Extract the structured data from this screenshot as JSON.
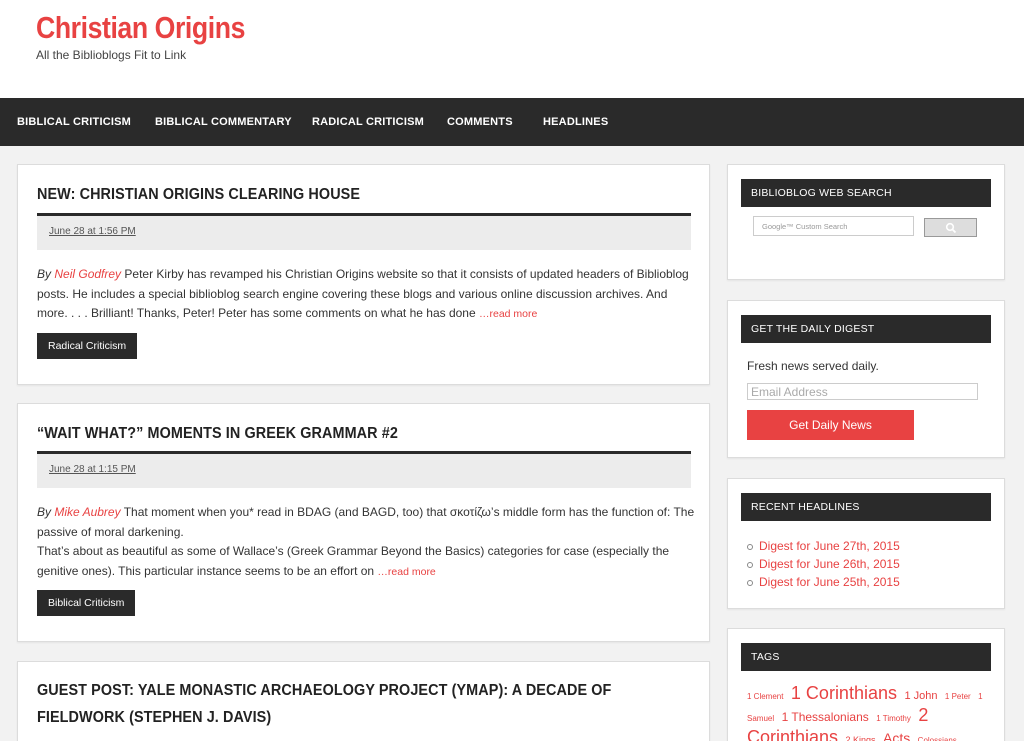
{
  "site": {
    "title": "Christian Origins",
    "description": "All the Biblioblogs Fit to Link"
  },
  "nav": {
    "items": [
      {
        "label": "BIBLICAL CRITICISM"
      },
      {
        "label": "BIBLICAL COMMENTARY"
      },
      {
        "label": "RADICAL CRITICISM"
      },
      {
        "label": "COMMENTS"
      },
      {
        "label": "HEADLINES"
      }
    ]
  },
  "posts": [
    {
      "title": "NEW: CHRISTIAN ORIGINS CLEARING HOUSE",
      "date": "June 28 at 1:56 PM",
      "by": "By",
      "author": "Neil Godfrey",
      "excerpt": " Peter Kirby has revamped his Christian Origins website so that it consists of updated headers of Biblioblog posts. He includes a special biblioblog search engine covering these blogs and various online discussion archives. And more. . . . Brilliant! Thanks, Peter! Peter has some comments on what he has done ",
      "readmore": "…read more",
      "category": "Radical Criticism"
    },
    {
      "title": "“WAIT WHAT?” MOMENTS IN GREEK GRAMMAR #2",
      "date": "June 28 at 1:15 PM",
      "by": "By",
      "author": "Mike Aubrey",
      "excerpt": " That moment when you* read in BDAG (and BAGD, too) that σκοτίζω’s middle form has the function of: The passive of moral darkening.",
      "excerpt2": "That’s about as beautiful as some of Wallace’s (Greek Grammar Beyond the Basics) categories for case (especially the genitive ones). This particular instance seems to be an effort on ",
      "readmore": "…read more",
      "category": "Biblical Criticism"
    },
    {
      "title": "GUEST POST: YALE MONASTIC ARCHAEOLOGY PROJECT (YMAP): A DECADE OF FIELDWORK (STEPHEN J. DAVIS)"
    }
  ],
  "sidebar": {
    "search": {
      "title": "BIBLIOBLOG WEB SEARCH",
      "placeholder": "Google™ Custom Search"
    },
    "digest": {
      "title": "GET THE DAILY DIGEST",
      "text": "Fresh news served daily.",
      "email_placeholder": "Email Address",
      "button": "Get Daily News"
    },
    "headlines": {
      "title": "RECENT HEADLINES",
      "items": [
        "Digest for June 27th, 2015",
        "Digest for June 26th, 2015",
        "Digest for June 25th, 2015"
      ]
    },
    "tags": {
      "title": "TAGS",
      "items": [
        {
          "label": "1 Clement",
          "size": 8
        },
        {
          "label": "1 Corinthians",
          "size": 18
        },
        {
          "label": "1 John",
          "size": 11
        },
        {
          "label": "1 Peter",
          "size": 8
        },
        {
          "label": "1 Samuel",
          "size": 8
        },
        {
          "label": "1 Thessalonians",
          "size": 12
        },
        {
          "label": "1 Timothy",
          "size": 8
        },
        {
          "label": "2 Corinthians",
          "size": 18
        },
        {
          "label": "2 Kings",
          "size": 9
        },
        {
          "label": "Acts",
          "size": 14
        },
        {
          "label": "Colossians",
          "size": 8
        }
      ]
    }
  },
  "colors": {
    "accent": "#e84242",
    "dark": "#2a2a2a"
  }
}
